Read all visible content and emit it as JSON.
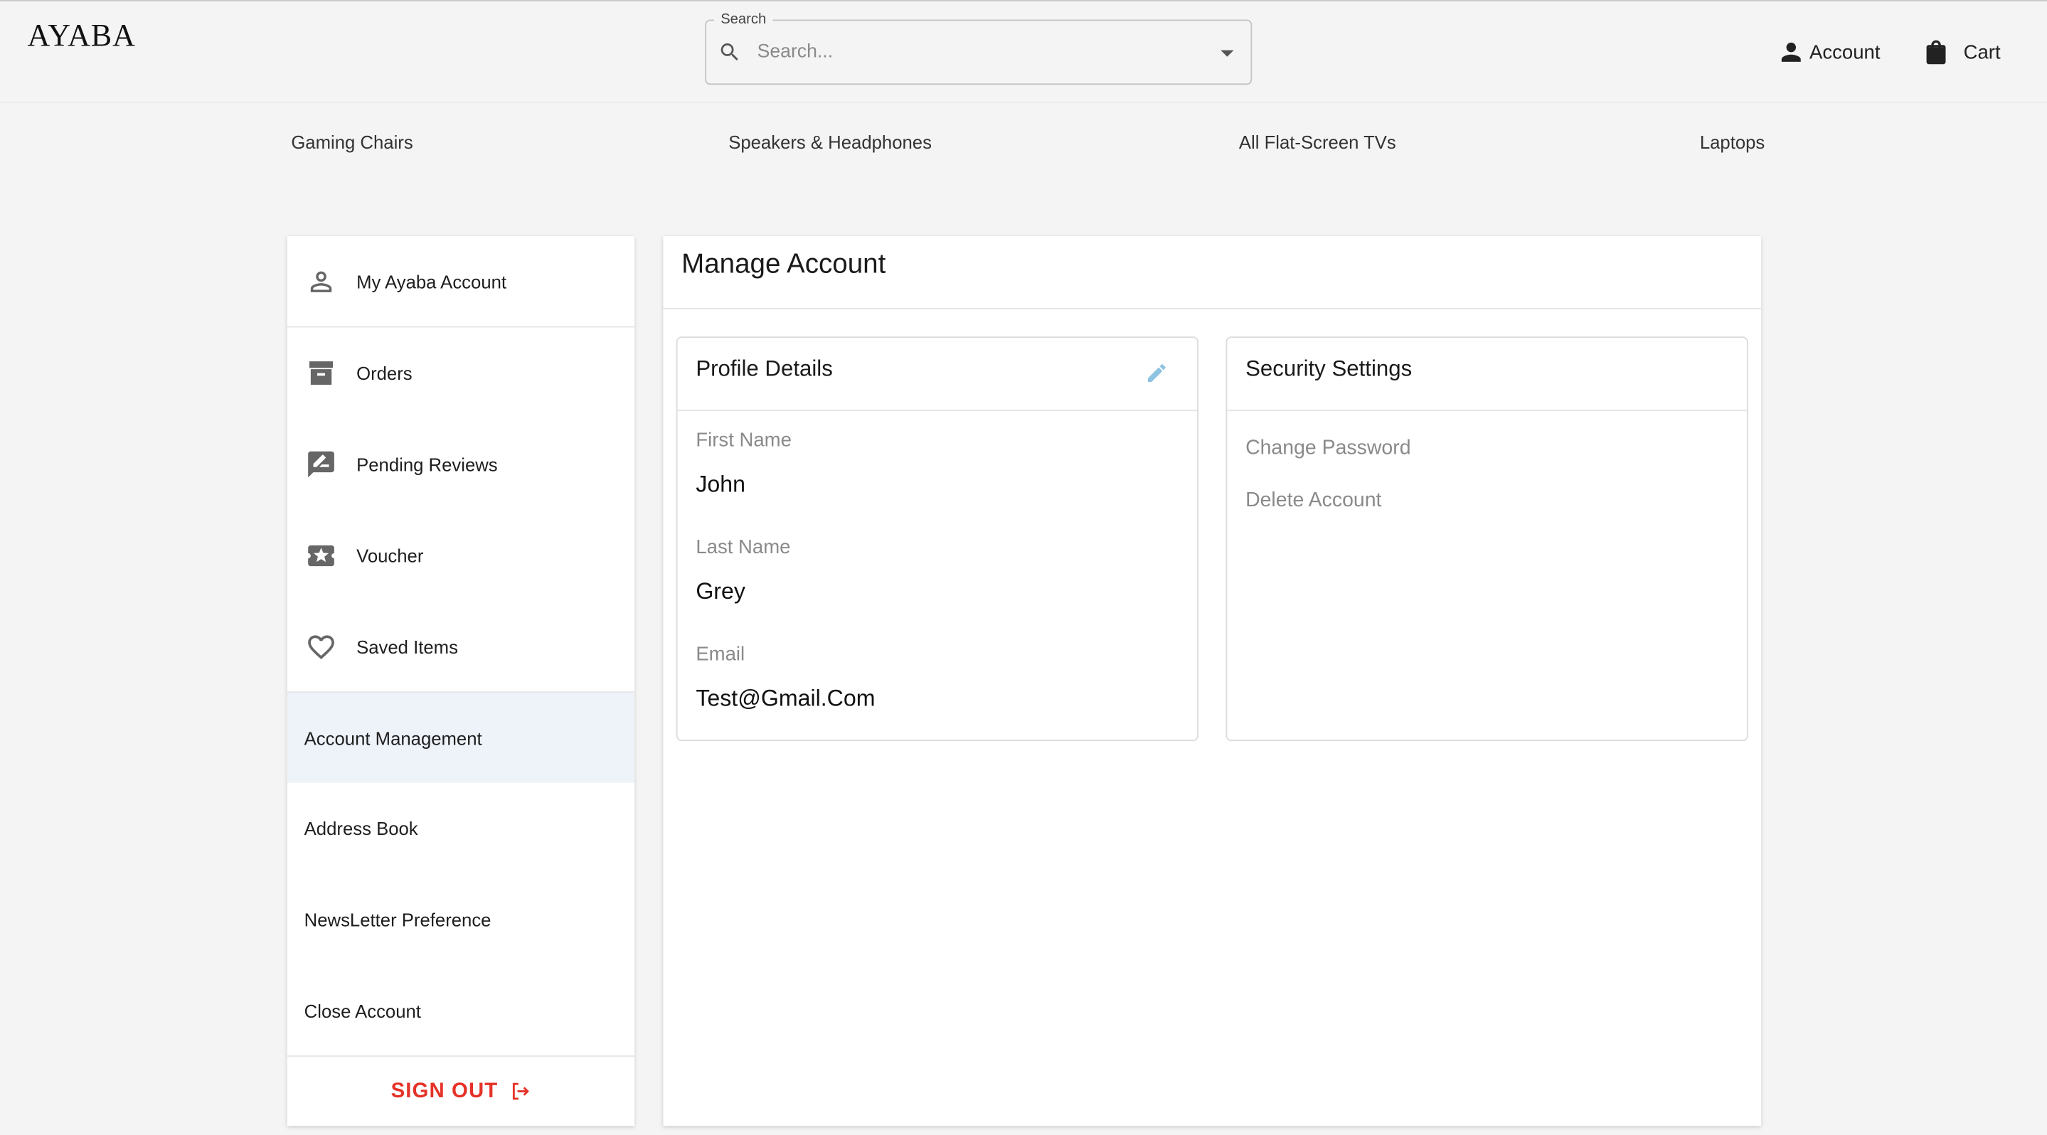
{
  "brand": {
    "logo": "AYABA"
  },
  "search": {
    "legend": "Search",
    "placeholder": "Search..."
  },
  "header": {
    "account_label": "Account",
    "cart_label": "Cart"
  },
  "categories": [
    "Gaming Chairs",
    "Speakers & Headphones",
    "All Flat-Screen TVs",
    "Laptops"
  ],
  "sidebar": {
    "items": [
      {
        "label": "My Ayaba Account",
        "icon": "person-icon"
      },
      {
        "label": "Orders",
        "icon": "archive-icon"
      },
      {
        "label": "Pending Reviews",
        "icon": "rate-review-icon"
      },
      {
        "label": "Voucher",
        "icon": "voucher-star-icon"
      },
      {
        "label": "Saved Items",
        "icon": "heart-icon"
      },
      {
        "label": "Account Management",
        "active": true
      },
      {
        "label": "Address Book"
      },
      {
        "label": "NewsLetter Preference"
      },
      {
        "label": "Close Account"
      }
    ],
    "signout_label": "SIGN OUT",
    "signout_color": "#e53228"
  },
  "main": {
    "title": "Manage Account",
    "profile": {
      "title": "Profile Details",
      "fields": [
        {
          "label": "First Name",
          "value": "John"
        },
        {
          "label": "Last Name",
          "value": "Grey"
        },
        {
          "label": "Email",
          "value": "Test@Gmail.Com"
        }
      ]
    },
    "security": {
      "title": "Security Settings",
      "links": [
        "Change Password",
        "Delete Account"
      ]
    }
  },
  "colors": {
    "accent_edit": "#8ec3e2",
    "active_bg": "#eef2f9"
  }
}
